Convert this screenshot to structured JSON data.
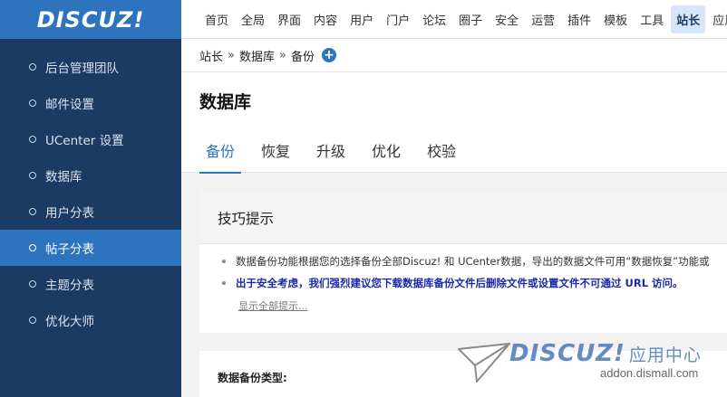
{
  "logo": {
    "text": "DISCUZ!"
  },
  "sidebar": {
    "items": [
      {
        "label": "后台管理团队"
      },
      {
        "label": "邮件设置"
      },
      {
        "label": "UCenter 设置"
      },
      {
        "label": "数据库"
      },
      {
        "label": "用户分表"
      },
      {
        "label": "帖子分表",
        "active": true
      },
      {
        "label": "主题分表"
      },
      {
        "label": "优化大师"
      }
    ]
  },
  "topnav": {
    "items": [
      "首页",
      "全局",
      "界面",
      "内容",
      "用户",
      "门户",
      "论坛",
      "圈子",
      "安全",
      "运营",
      "插件",
      "模板",
      "工具",
      "站长",
      "应用"
    ],
    "active": "站长"
  },
  "breadcrumb": {
    "items": [
      "站长",
      "数据库",
      "备份"
    ],
    "separator": "»",
    "add_icon": "plus-circle-icon"
  },
  "page": {
    "title": "数据库",
    "tabs": [
      "备份",
      "恢复",
      "升级",
      "优化",
      "校验"
    ],
    "active_tab": "备份"
  },
  "tips": {
    "title": "技巧提示",
    "items": [
      "数据备份功能根据您的选择备份全部Discuz! 和 UCenter数据，导出的数据文件可用“数据恢复”功能或",
      "出于安全考虑，我们强烈建议您下载数据库备份文件后删除文件或设置文件不可通过 URL 访问。"
    ],
    "show_all": "显示全部提示..."
  },
  "backup": {
    "type_label": "数据备份类型:"
  },
  "watermark": {
    "brand": "DISCUZ!",
    "cn": "应用中心",
    "url": "addon.dismall.com"
  },
  "colors": {
    "sidebar": "#1b3b63",
    "accent": "#2e73bd",
    "strong_tip": "#1b28a8"
  }
}
